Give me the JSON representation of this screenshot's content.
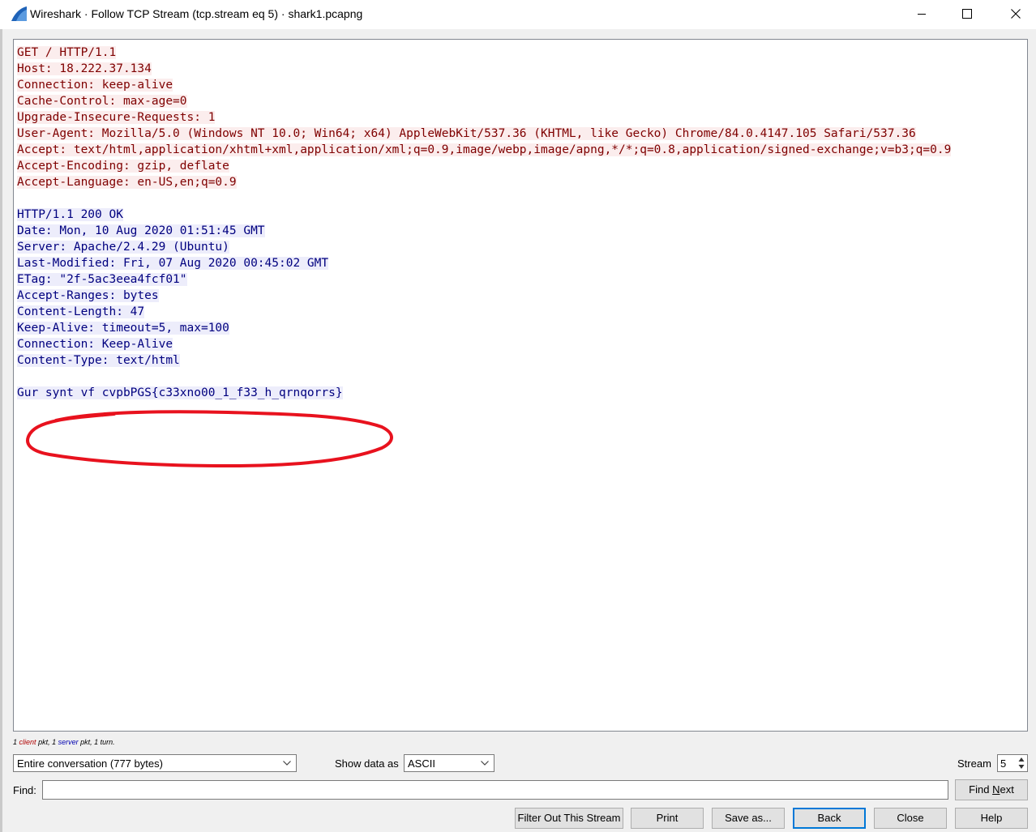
{
  "window": {
    "title": "Wireshark · Follow TCP Stream (tcp.stream eq 5) · shark1.pcapng",
    "icon": "wireshark-fin-icon",
    "controls": [
      "minimize-icon",
      "maximize-icon",
      "close-icon"
    ]
  },
  "stream": {
    "lines": [
      {
        "side": "client",
        "text": "GET / HTTP/1.1"
      },
      {
        "side": "client",
        "text": "Host: 18.222.37.134"
      },
      {
        "side": "client",
        "text": "Connection: keep-alive"
      },
      {
        "side": "client",
        "text": "Cache-Control: max-age=0"
      },
      {
        "side": "client",
        "text": "Upgrade-Insecure-Requests: 1"
      },
      {
        "side": "client",
        "text": "User-Agent: Mozilla/5.0 (Windows NT 10.0; Win64; x64) AppleWebKit/537.36 (KHTML, like Gecko) Chrome/84.0.4147.105 Safari/537.36"
      },
      {
        "side": "client",
        "text": "Accept: text/html,application/xhtml+xml,application/xml;q=0.9,image/webp,image/apng,*/*;q=0.8,application/signed-exchange;v=b3;q=0.9"
      },
      {
        "side": "client",
        "text": "Accept-Encoding: gzip, deflate"
      },
      {
        "side": "client",
        "text": "Accept-Language: en-US,en;q=0.9"
      },
      {
        "side": "blank",
        "text": ""
      },
      {
        "side": "server",
        "text": "HTTP/1.1 200 OK"
      },
      {
        "side": "server",
        "text": "Date: Mon, 10 Aug 2020 01:51:45 GMT"
      },
      {
        "side": "server",
        "text": "Server: Apache/2.4.29 (Ubuntu)"
      },
      {
        "side": "server",
        "text": "Last-Modified: Fri, 07 Aug 2020 00:45:02 GMT"
      },
      {
        "side": "server",
        "text": "ETag: \"2f-5ac3eea4fcf01\""
      },
      {
        "side": "server",
        "text": "Accept-Ranges: bytes"
      },
      {
        "side": "server",
        "text": "Content-Length: 47"
      },
      {
        "side": "server",
        "text": "Keep-Alive: timeout=5, max=100"
      },
      {
        "side": "server",
        "text": "Connection: Keep-Alive"
      },
      {
        "side": "server",
        "text": "Content-Type: text/html"
      },
      {
        "side": "blank",
        "text": ""
      },
      {
        "side": "server",
        "text": "Gur synt vf cvpbPGS{c33xno00_1_f33_h_qrnqorrs}"
      }
    ],
    "colors": {
      "client_fg": "#7f0000",
      "client_bg": "#fbeded",
      "server_fg": "#00007f",
      "server_bg": "#ededfb",
      "annotation": "#e8121e"
    }
  },
  "stats": {
    "client_count": "1",
    "client_word": "client",
    "mid1": "pkt, 1",
    "server_word": "server",
    "tail": "pkt, 1 turn."
  },
  "controls": {
    "conversation_value": "Entire conversation (777 bytes)",
    "show_data_label": "Show data as",
    "show_data_value": "ASCII",
    "stream_label": "Stream",
    "stream_value": "5",
    "find_label": "Find:",
    "find_value": "",
    "find_next_pre": "Find ",
    "find_next_u": "N",
    "find_next_post": "ext"
  },
  "buttons": {
    "filter_out": "Filter Out This Stream",
    "print": "Print",
    "save_as": "Save as...",
    "back": "Back",
    "close": "Close",
    "help": "Help"
  }
}
